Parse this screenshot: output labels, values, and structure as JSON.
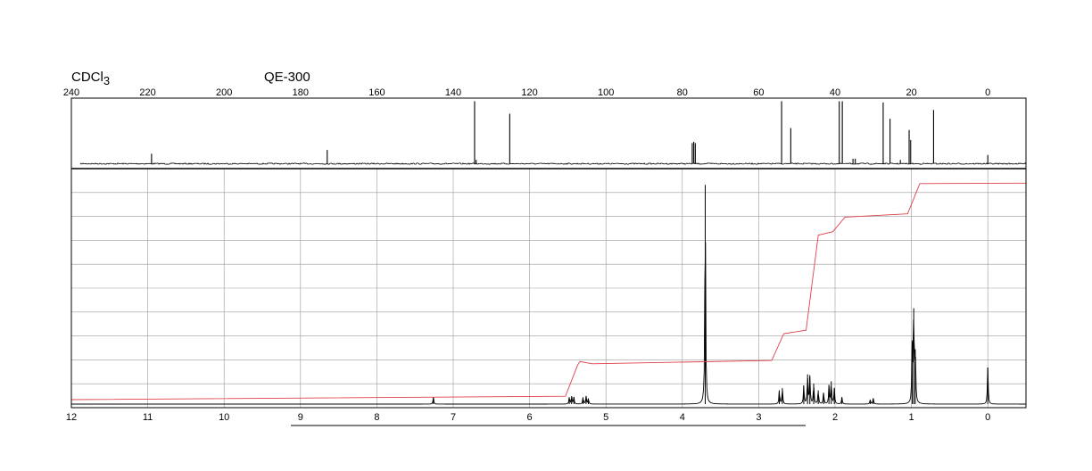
{
  "header": {
    "solvent": "CDCl3",
    "instrument": "QE-300"
  },
  "colors": {
    "frame": "#000000",
    "grid": "#9a9a9a",
    "spectrum": "#000000",
    "integral": "#e0404a"
  },
  "chart_data": [
    {
      "type": "line",
      "name": "13C NMR",
      "x_axis": {
        "reversed": true,
        "range": [
          240,
          -10
        ],
        "tick_labels": [
          "240",
          "220",
          "200",
          "180",
          "160",
          "140",
          "120",
          "100",
          "80",
          "60",
          "40",
          "20",
          "0"
        ],
        "ticks": [
          240,
          220,
          200,
          180,
          160,
          140,
          120,
          100,
          80,
          60,
          40,
          20,
          0
        ]
      },
      "ylim": [
        0,
        1
      ],
      "grid": false,
      "peaks": [
        {
          "ppm": 219.0,
          "height": 0.16
        },
        {
          "ppm": 173.0,
          "height": 0.22
        },
        {
          "ppm": 134.4,
          "height": 1.0
        },
        {
          "ppm": 134.0,
          "height": 0.06
        },
        {
          "ppm": 125.2,
          "height": 0.8
        },
        {
          "ppm": 77.4,
          "height": 0.33
        },
        {
          "ppm": 77.0,
          "height": 0.35
        },
        {
          "ppm": 76.6,
          "height": 0.33
        },
        {
          "ppm": 54.0,
          "height": 1.0
        },
        {
          "ppm": 51.6,
          "height": 0.57
        },
        {
          "ppm": 38.9,
          "height": 1.0
        },
        {
          "ppm": 38.1,
          "height": 1.0
        },
        {
          "ppm": 35.3,
          "height": 0.08
        },
        {
          "ppm": 34.7,
          "height": 0.08
        },
        {
          "ppm": 27.4,
          "height": 0.98
        },
        {
          "ppm": 25.6,
          "height": 0.72
        },
        {
          "ppm": 22.9,
          "height": 0.06
        },
        {
          "ppm": 20.6,
          "height": 0.54
        },
        {
          "ppm": 20.2,
          "height": 0.38
        },
        {
          "ppm": 14.2,
          "height": 0.86
        },
        {
          "ppm": 0.0,
          "height": 0.14
        }
      ]
    },
    {
      "type": "line",
      "name": "1H NMR",
      "x_axis": {
        "reversed": true,
        "range": [
          12,
          -0.5
        ],
        "tick_labels": [
          "12",
          "11",
          "10",
          "9",
          "8",
          "7",
          "6",
          "5",
          "4",
          "3",
          "2",
          "1",
          "0"
        ],
        "ticks": [
          12,
          11,
          10,
          9,
          8,
          7,
          6,
          5,
          4,
          3,
          2,
          1,
          0
        ]
      },
      "ylim": [
        0,
        1
      ],
      "grid": true,
      "peaks": [
        {
          "ppm": 7.26,
          "height": 0.03
        },
        {
          "ppm": 5.48,
          "height": 0.03
        },
        {
          "ppm": 5.45,
          "height": 0.035
        },
        {
          "ppm": 5.42,
          "height": 0.03
        },
        {
          "ppm": 5.3,
          "height": 0.03
        },
        {
          "ppm": 5.26,
          "height": 0.035
        },
        {
          "ppm": 5.23,
          "height": 0.025
        },
        {
          "ppm": 3.7,
          "height": 0.96
        },
        {
          "ppm": 2.73,
          "height": 0.06
        },
        {
          "ppm": 2.69,
          "height": 0.07
        },
        {
          "ppm": 2.41,
          "height": 0.08
        },
        {
          "ppm": 2.36,
          "height": 0.13
        },
        {
          "ppm": 2.33,
          "height": 0.12
        },
        {
          "ppm": 2.28,
          "height": 0.09
        },
        {
          "ppm": 2.22,
          "height": 0.06
        },
        {
          "ppm": 2.15,
          "height": 0.05
        },
        {
          "ppm": 2.08,
          "height": 0.08
        },
        {
          "ppm": 2.05,
          "height": 0.1
        },
        {
          "ppm": 2.01,
          "height": 0.07
        },
        {
          "ppm": 1.91,
          "height": 0.03
        },
        {
          "ppm": 1.54,
          "height": 0.02
        },
        {
          "ppm": 1.5,
          "height": 0.025
        },
        {
          "ppm": 0.99,
          "height": 0.25
        },
        {
          "ppm": 0.97,
          "height": 0.42
        },
        {
          "ppm": 0.95,
          "height": 0.24
        },
        {
          "ppm": 0.0,
          "height": 0.16
        }
      ],
      "integral_steps": [
        {
          "ppm": 5.45,
          "level_after": 0.155
        },
        {
          "ppm": 5.26,
          "level_after": 0.16
        },
        {
          "ppm": 2.75,
          "level_after": 0.295
        },
        {
          "ppm": 2.3,
          "level_after": 0.735
        },
        {
          "ppm": 1.95,
          "level_after": 0.815
        },
        {
          "ppm": 0.97,
          "level_after": 0.965
        }
      ]
    }
  ]
}
